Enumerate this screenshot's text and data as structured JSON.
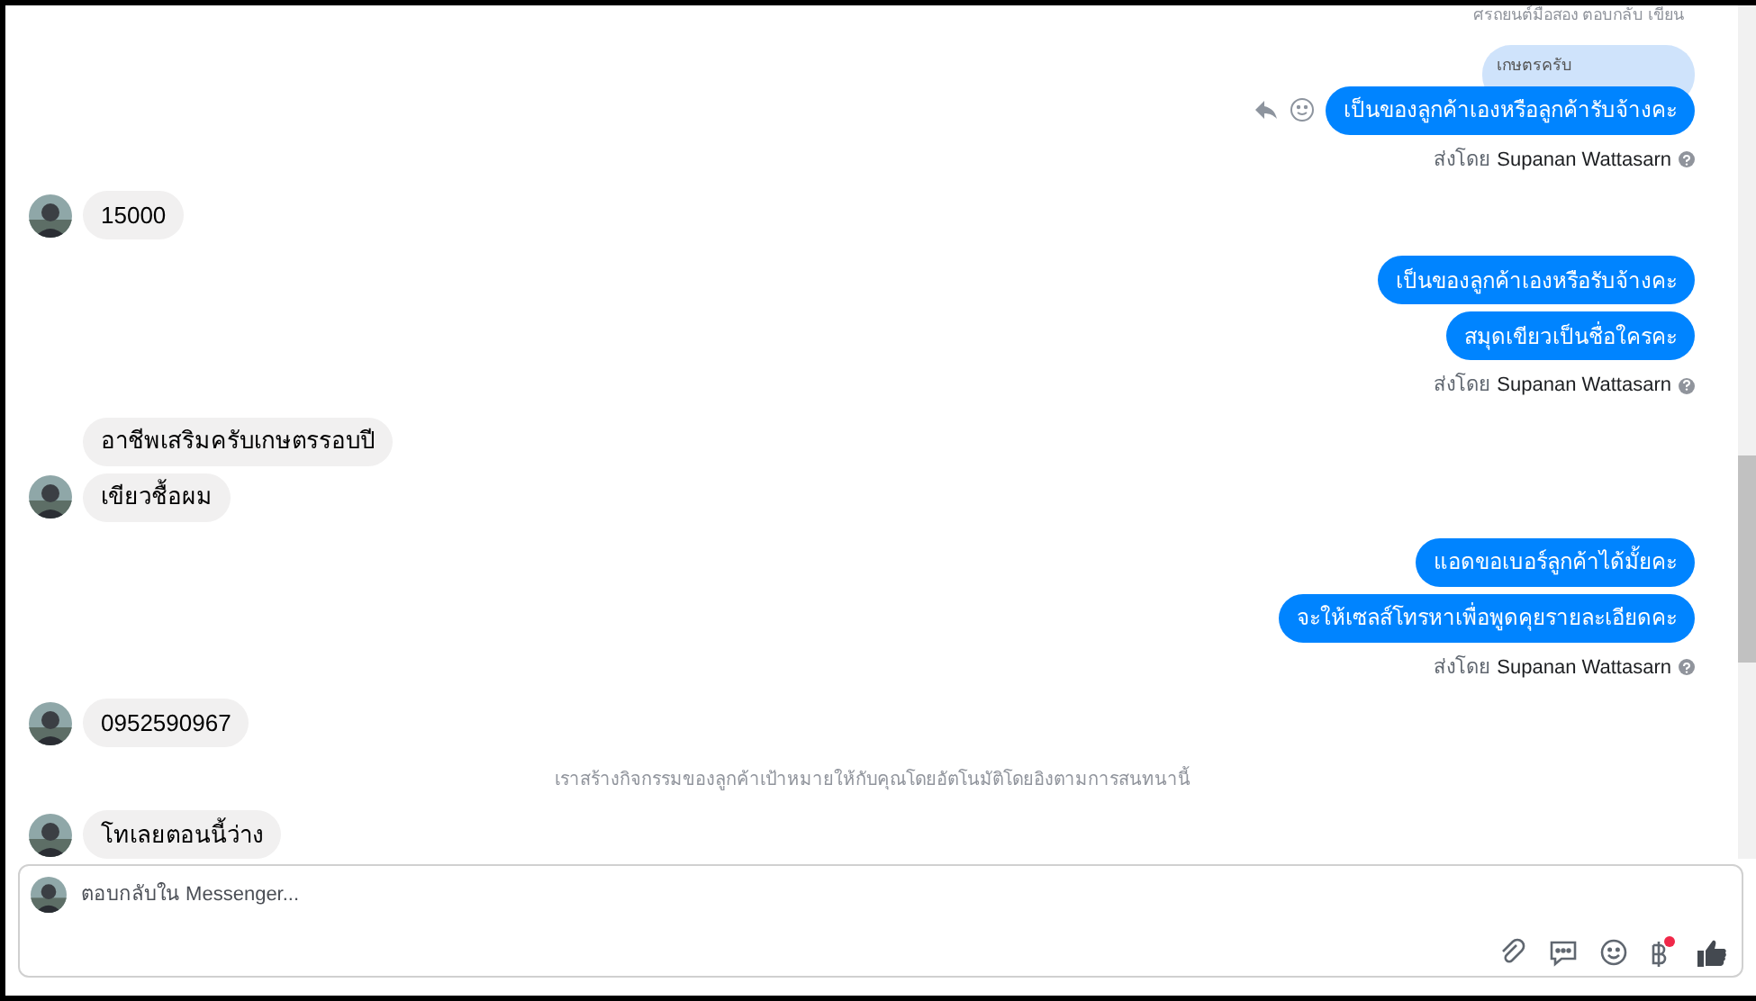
{
  "thread": {
    "top_note": "ศรถยนต์มือสอง ตอบกลับ เขียน",
    "items": [
      {
        "kind": "outgoing",
        "reply_to": "เกษตรครับ",
        "show_actions": true,
        "messages": [
          "เป็นของลูกค้าเองหรือลูกค้ารับจ้างคะ"
        ],
        "sent_by_label": "ส่งโดย",
        "sender": "Supanan Wattasarn"
      },
      {
        "kind": "incoming",
        "messages": [
          "15000"
        ]
      },
      {
        "kind": "outgoing",
        "show_actions": false,
        "messages": [
          "เป็นของลูกค้าเองหรือรับจ้างคะ",
          "สมุดเขียวเป็นชื่อใครคะ"
        ],
        "sent_by_label": "ส่งโดย",
        "sender": "Supanan Wattasarn"
      },
      {
        "kind": "incoming",
        "messages": [
          "อาชีพเสริมครับเกษตรรอบปี",
          "เขียวชื้อผม"
        ]
      },
      {
        "kind": "outgoing",
        "show_actions": false,
        "messages": [
          "แอดขอเบอร์ลูกค้าได้มั้ยคะ",
          "จะให้เซลส์โทรหาเพื่อพูดคุยรายละเอียดคะ"
        ],
        "sent_by_label": "ส่งโดย",
        "sender": "Supanan Wattasarn"
      },
      {
        "kind": "incoming",
        "messages": [
          "0952590967"
        ]
      },
      {
        "kind": "system",
        "text": "เราสร้างกิจกรรมของลูกค้าเป้าหมายให้กับคุณโดยอัตโนมัติโดยอิงตามการสนทนานี้"
      },
      {
        "kind": "incoming",
        "messages": [
          "โทเลยตอนนี้ว่าง"
        ]
      }
    ]
  },
  "composer": {
    "placeholder": "ตอบกลับใน Messenger...",
    "payment_badge": true
  }
}
